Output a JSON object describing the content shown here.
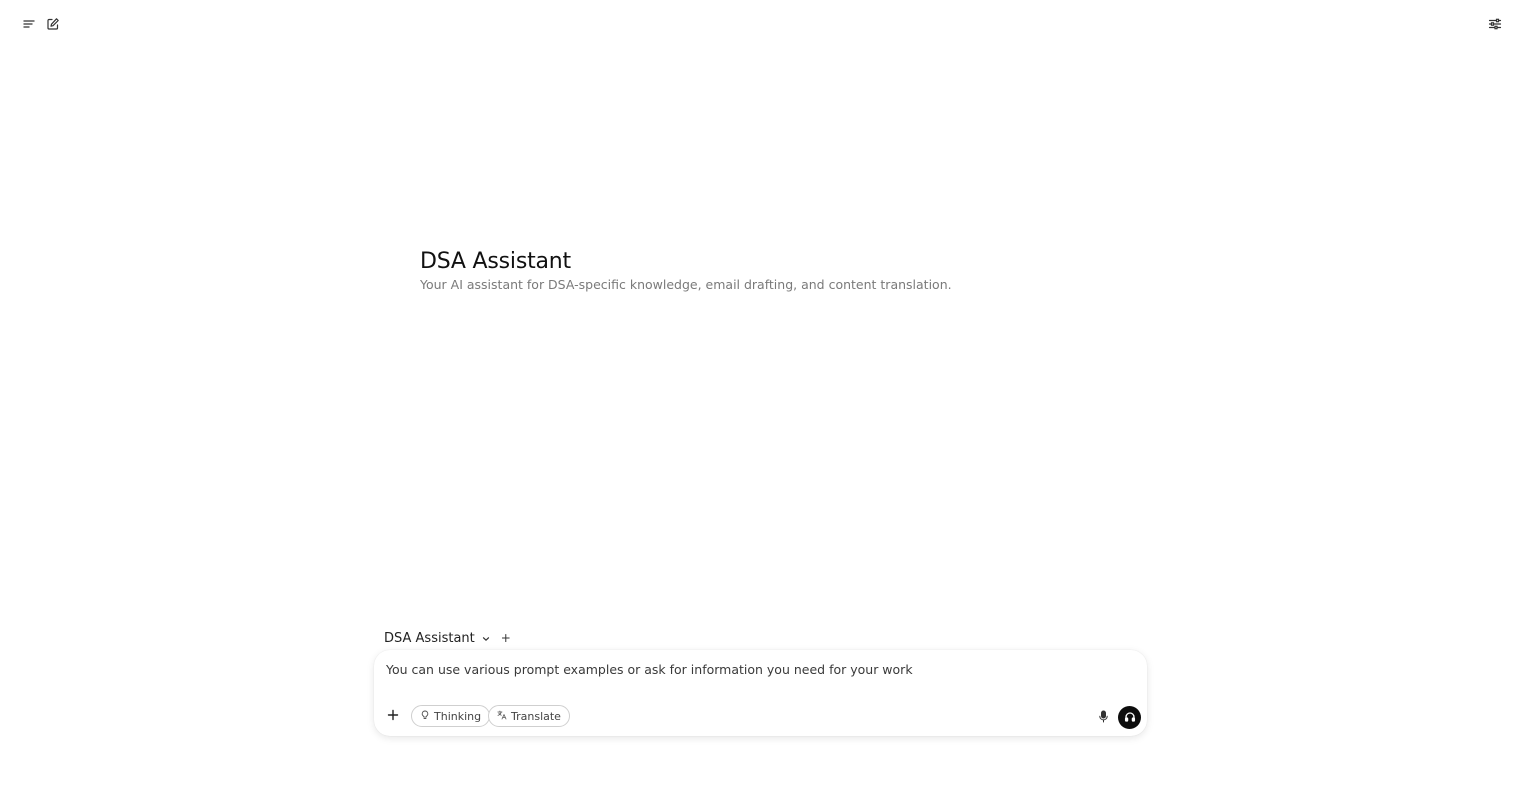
{
  "header": {
    "menu_icon": "menu-icon",
    "new_chat_icon": "edit-icon",
    "controls_icon": "sliders-icon"
  },
  "hero": {
    "title": "DSA Assistant",
    "subtitle": "Your AI assistant for DSA-specific knowledge, email drafting, and content translation."
  },
  "model_selector": {
    "selected": "DSA Assistant",
    "add_label": "+"
  },
  "composer": {
    "placeholder": "You can use various prompt examples or ask for information you need for your work",
    "value": "",
    "chips": [
      {
        "label": "Thinking",
        "icon": "lightbulb-icon"
      },
      {
        "label": "Translate",
        "icon": "translate-icon"
      }
    ],
    "mic_icon": "microphone-icon",
    "voice_icon": "headphones-icon"
  },
  "colors": {
    "background": "#ffffff",
    "text_primary": "#111111",
    "text_secondary": "#7a7a7a",
    "voice_button": "#0d0d0d",
    "chip_border": "#cfcfcf"
  }
}
